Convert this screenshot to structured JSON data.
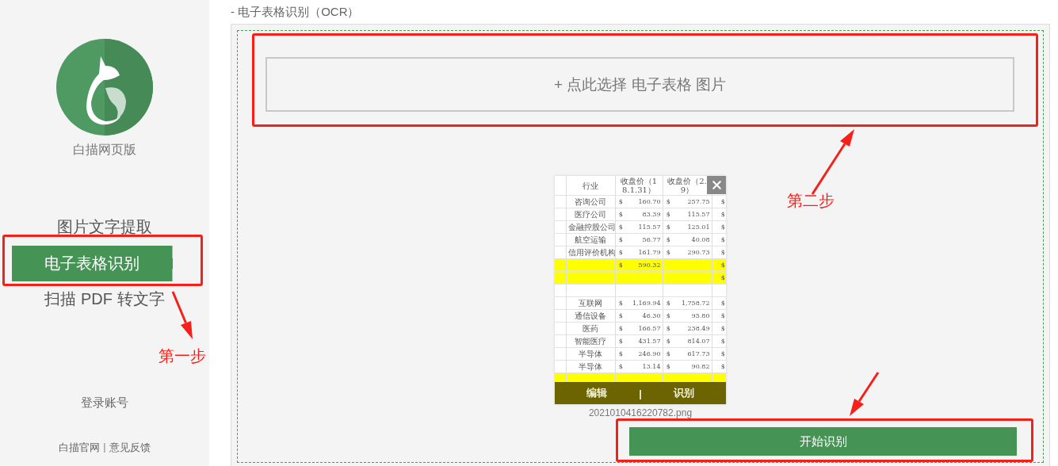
{
  "page_title": "- 电子表格识别（OCR）",
  "sidebar": {
    "app_name": "白描网页版",
    "nav": [
      {
        "label": "图片文字提取",
        "selected": false
      },
      {
        "label": "电子表格识别",
        "selected": true
      },
      {
        "label": "扫描 PDF 转文字",
        "selected": false
      }
    ],
    "login": "登录账号",
    "footer_links": [
      "白描官网",
      "意见反馈"
    ],
    "footer_separator": "|"
  },
  "upload": {
    "label": "+ 点此选择 电子表格 图片"
  },
  "thumbnail": {
    "filename": "2021010416220782.png",
    "actions": [
      "编辑",
      "识别"
    ],
    "action_separator": "|",
    "sheet": {
      "header": [
        "行业",
        "收盘价（18.1.31）",
        "收盘价（2.9）"
      ],
      "rows": [
        {
          "highlight": false,
          "cells": [
            null,
            "咨询公司",
            "$",
            "160.70",
            "$",
            "257.75",
            "$"
          ]
        },
        {
          "highlight": false,
          "cells": [
            null,
            "医疗公司",
            "$",
            "83.39",
            "$",
            "115.57",
            "$"
          ]
        },
        {
          "highlight": false,
          "cells": [
            null,
            "金融控股公司",
            "$",
            "115.57",
            "$",
            "125.01",
            "$"
          ]
        },
        {
          "highlight": false,
          "cells": [
            null,
            "航空运输",
            "$",
            "56.77",
            "$",
            "40.08",
            "$"
          ]
        },
        {
          "highlight": false,
          "cells": [
            null,
            "信用评价机构",
            "$",
            "161.79",
            "$",
            "290.73",
            "$"
          ]
        },
        {
          "highlight": true,
          "cells": [
            null,
            null,
            "$",
            "590.32",
            null,
            null,
            "$"
          ]
        },
        {
          "highlight": true,
          "cells": [
            null,
            null,
            null,
            null,
            null,
            null,
            "$"
          ]
        },
        {
          "highlight": false,
          "cells": [
            null,
            null,
            null,
            null,
            null,
            null,
            null
          ]
        },
        {
          "highlight": false,
          "cells": [
            null,
            "互联网",
            "$",
            "1,169.94",
            "$",
            "1,758.72",
            "$"
          ]
        },
        {
          "highlight": false,
          "cells": [
            null,
            "通信设备",
            "$",
            "46.30",
            "$",
            "95.80",
            "$"
          ]
        },
        {
          "highlight": false,
          "cells": [
            null,
            "医药",
            "$",
            "166.57",
            "$",
            "238.49",
            "$"
          ]
        },
        {
          "highlight": false,
          "cells": [
            null,
            "智能医疗",
            "$",
            "431.57",
            "$",
            "814.07",
            "$"
          ]
        },
        {
          "highlight": false,
          "cells": [
            null,
            "半导体",
            "$",
            "246.90",
            "$",
            "617.73",
            "$"
          ]
        },
        {
          "highlight": false,
          "cells": [
            null,
            "半导体",
            "$",
            "13.14",
            "$",
            "90.82",
            "$"
          ]
        },
        {
          "highlight": true,
          "cells": [
            null,
            null,
            null,
            null,
            null,
            null,
            null
          ]
        }
      ]
    }
  },
  "start_button": "开始识别",
  "annotations": [
    {
      "text": "第一步"
    },
    {
      "text": "第二步"
    }
  ]
}
